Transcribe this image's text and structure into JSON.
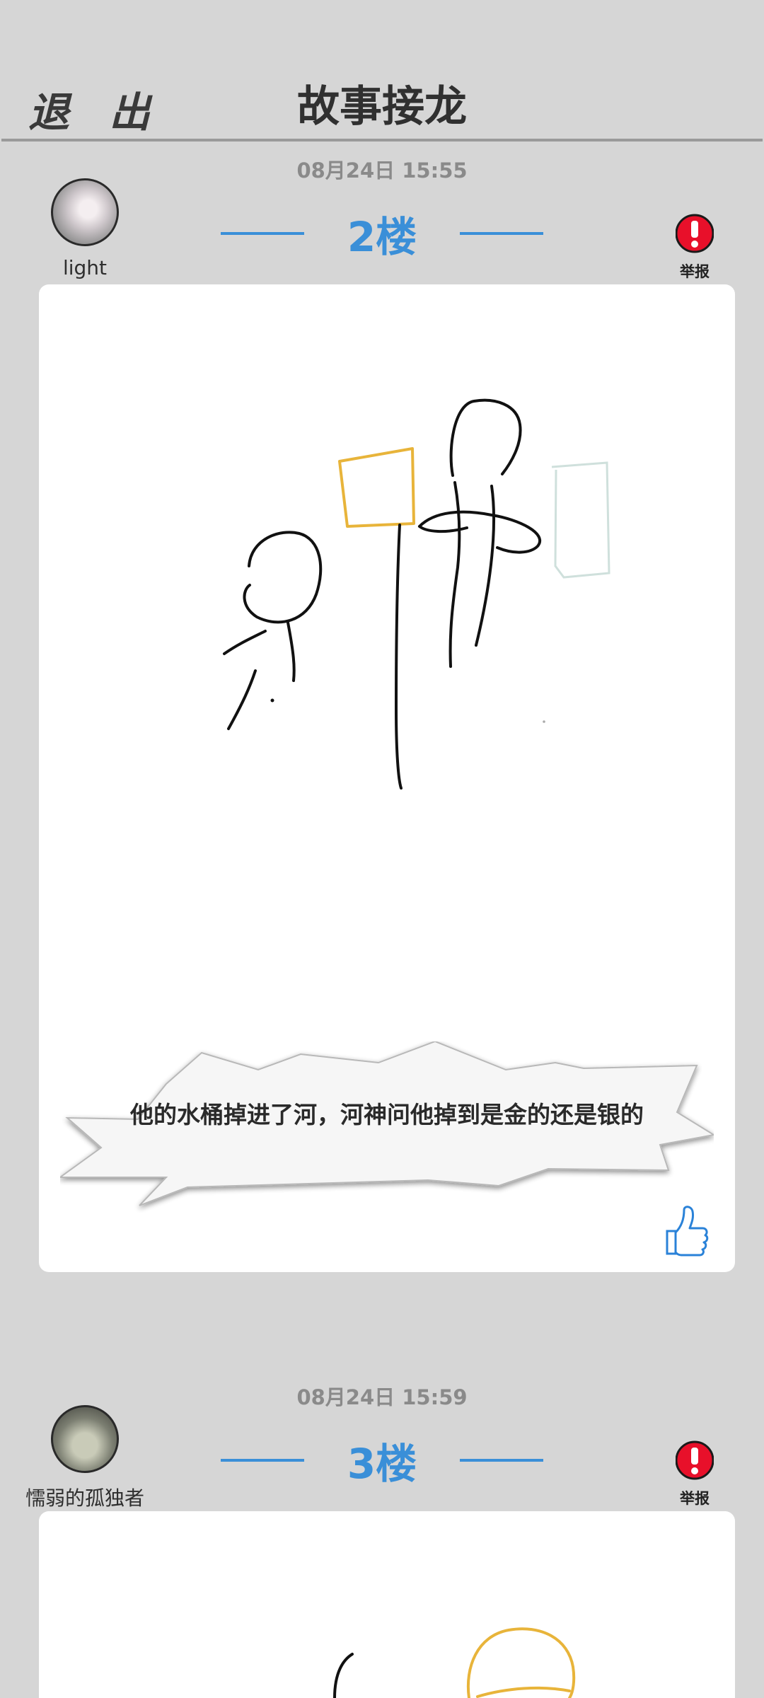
{
  "header": {
    "exit_label": "退 出",
    "title": "故事接龙"
  },
  "posts": [
    {
      "timestamp": "08月24日  15:55",
      "username": "light",
      "floor": "2楼",
      "report_label": "举报",
      "caption": "他的水桶掉进了河，河神问他掉到是金的还是银的"
    },
    {
      "timestamp": "08月24日  15:59",
      "username": "懦弱的孤独者",
      "floor": "3楼",
      "report_label": "举报"
    }
  ],
  "colors": {
    "accent": "#3a8fd8",
    "report": "#e8102a",
    "background": "#d6d6d6",
    "sketch_gold": "#e8b43a"
  }
}
